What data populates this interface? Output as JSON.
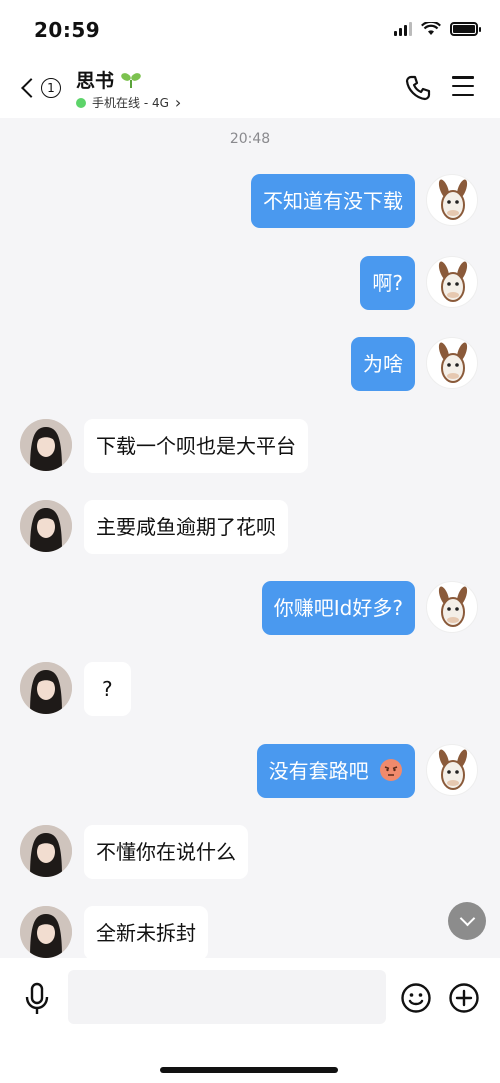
{
  "status_bar": {
    "time": "20:59"
  },
  "header": {
    "back_badge": "1",
    "contact_name": "思书",
    "online_status": "手机在线 - 4G",
    "online_arrow": "›"
  },
  "chat": {
    "timestamp": "20:48",
    "messages": [
      {
        "sender": "self",
        "text": "不知道有没下载"
      },
      {
        "sender": "self",
        "text": "啊?"
      },
      {
        "sender": "self",
        "text": "为啥"
      },
      {
        "sender": "other",
        "text": "下载一个呗也是大平台"
      },
      {
        "sender": "other",
        "text": "主要咸鱼逾期了花呗"
      },
      {
        "sender": "self",
        "text": "你赚吧Id好多?"
      },
      {
        "sender": "other",
        "text": "?"
      },
      {
        "sender": "self",
        "text": "没有套路吧"
      },
      {
        "sender": "other",
        "text": "不懂你在说什么"
      },
      {
        "sender": "other",
        "text": "全新未拆封"
      }
    ]
  },
  "input_bar": {
    "placeholder": ""
  },
  "colors": {
    "self_bubble": "#4a99ef",
    "online_dot": "#5dd46a",
    "background": "#f5f5f7"
  },
  "icons": [
    "back-arrow-icon",
    "sprout-icon",
    "phone-icon",
    "menu-icon",
    "microphone-icon",
    "emoji-icon",
    "plus-icon",
    "chevron-down-icon",
    "angry-face-icon"
  ]
}
